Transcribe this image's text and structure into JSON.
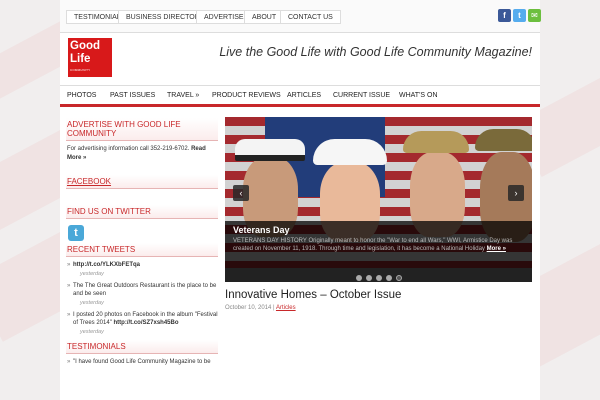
{
  "top_nav": [
    "TESTIMONIALS",
    "BUSINESS DIRECTORY",
    "ADVERTISE",
    "ABOUT",
    "CONTACT US"
  ],
  "social_icons": [
    "facebook-icon",
    "twitter-icon",
    "email-icon"
  ],
  "logo": {
    "line1": "Good",
    "line2": "Life",
    "line3": "COMMUNITY"
  },
  "tagline": "Live the Good Life with Good Life Community Magazine!",
  "main_nav": [
    "PHOTOS",
    "PAST ISSUES",
    "TRAVEL »",
    "PRODUCT REVIEWS",
    "ARTICLES",
    "CURRENT ISSUE",
    "WHAT'S ON"
  ],
  "sidebar": {
    "advertise_heading": "ADVERTISE WITH GOOD LIFE COMMUNITY",
    "advertise_text": "For advertising information call 352-219-6702.",
    "read_more": "Read More »",
    "facebook_heading": "FACEBOOK",
    "twitter_heading": "FIND US ON TWITTER",
    "recent_tweets_heading": "RECENT TWEETS",
    "tweets": [
      {
        "text": "http://t.co/YLKXbFETqa",
        "time": "yesterday"
      },
      {
        "text": "The The Great Outdoors Restaurant is the place to be and be seen",
        "time": "yesterday"
      },
      {
        "text_pre": "I posted 20 photos on Facebook in the album \"Festival of Trees 2014\" ",
        "link": "http://t.co/SZ7xsh45Bo",
        "time": "yesterday"
      }
    ],
    "testimonials_heading": "TESTIMONIALS",
    "testimonials_text": "\"I have found Good Life Community Magazine to be"
  },
  "slider": {
    "title": "Veterans Day",
    "text": "VETERANS DAY HISTORY Originally meant to honor the \"War to end all Wars,\" WWI, Armistice Day was created on November 11, 1918. Through time and legislation, it has become a National Holiday",
    "more": "More »",
    "prev_icon": "chevron-left-icon",
    "next_icon": "chevron-right-icon",
    "dot_count": 5,
    "active_dot": 5
  },
  "post": {
    "title": "Innovative Homes – October Issue",
    "date": "October 10, 2014",
    "separator": "|",
    "category": "Articles"
  },
  "colors": {
    "accent": "#c8282a",
    "logo_bg": "#d8191a"
  }
}
